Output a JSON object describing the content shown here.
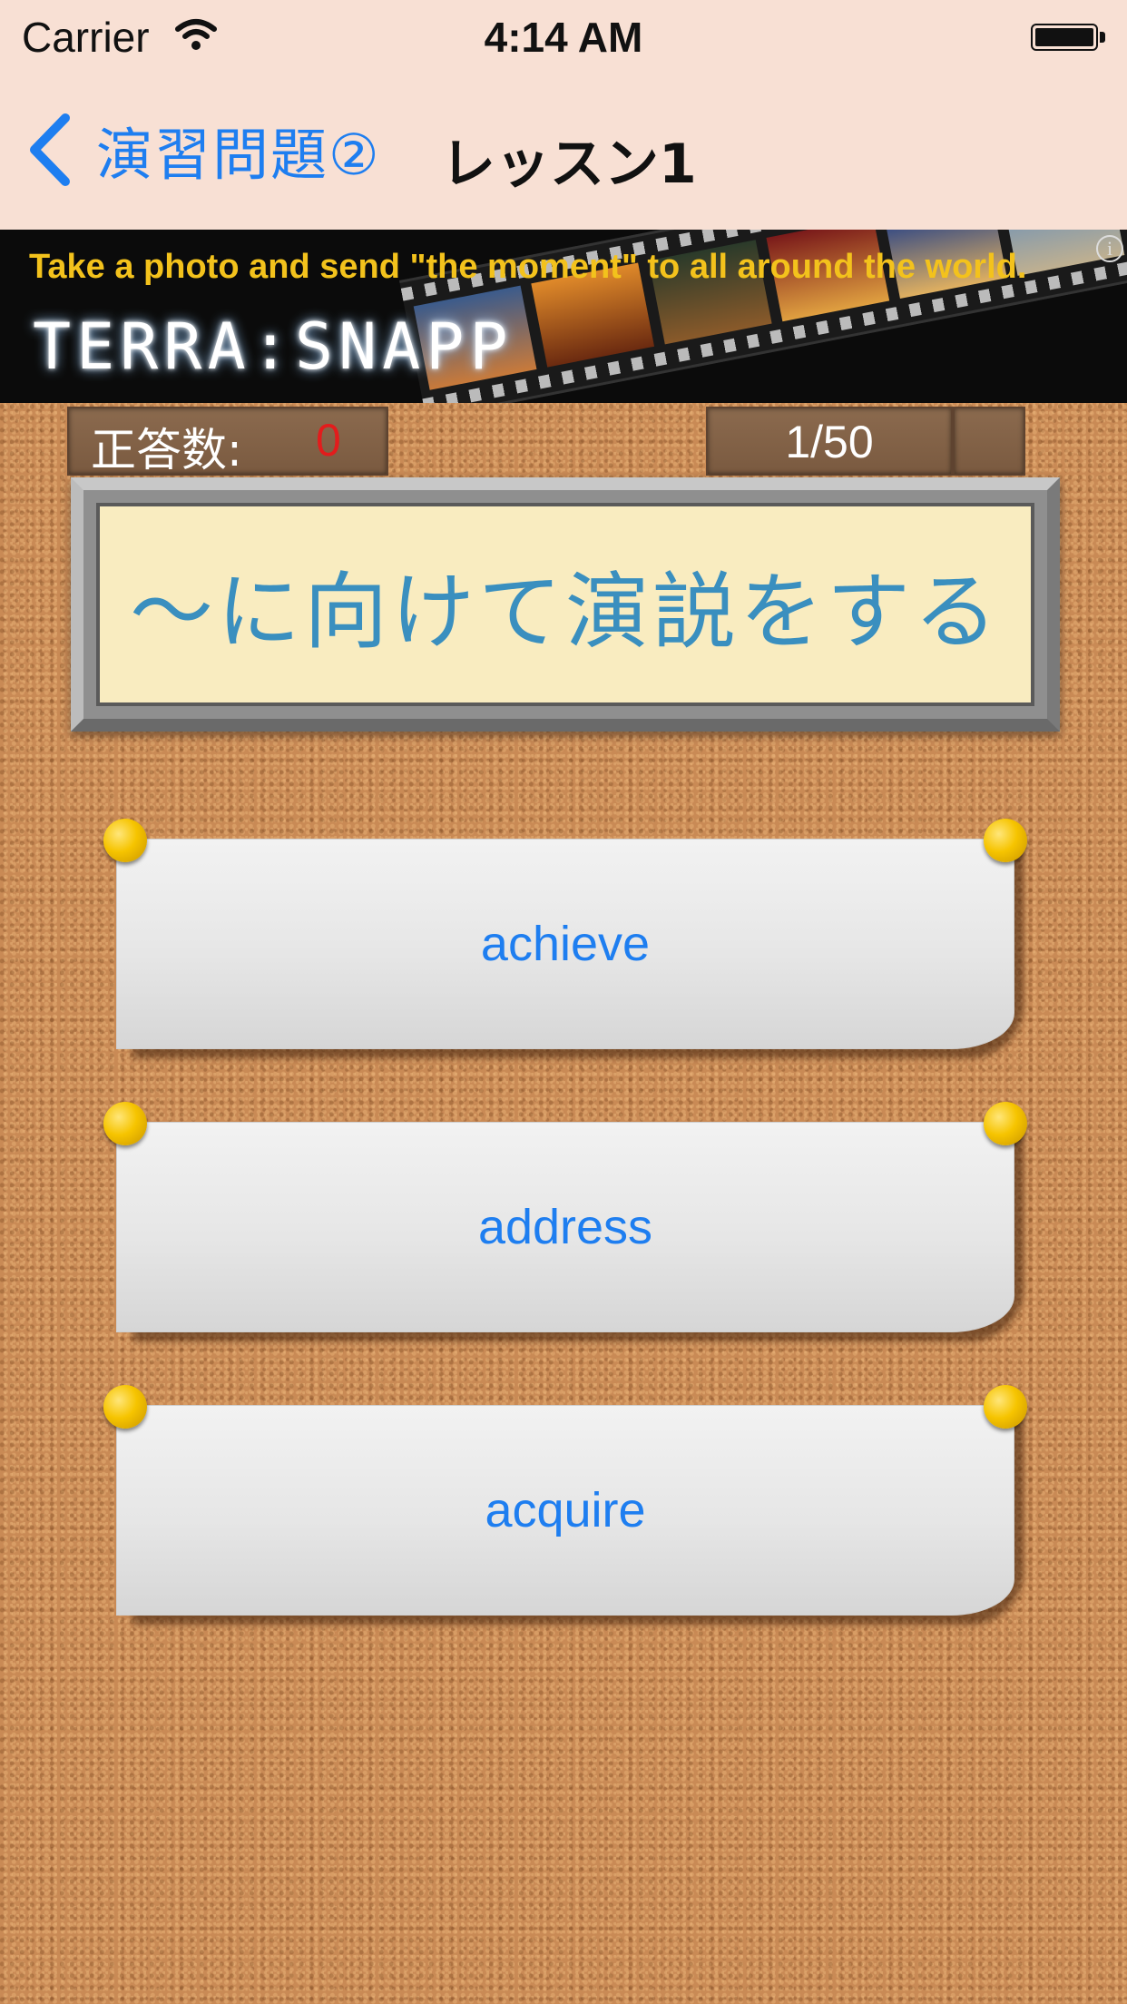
{
  "status_bar": {
    "carrier": "Carrier",
    "time": "4:14 AM",
    "wifi_icon": "wifi-icon",
    "battery_icon": "battery-icon"
  },
  "nav": {
    "back_label": "演習問題②",
    "title": "レッスン1",
    "accent_color": "#1e7ef0"
  },
  "ad": {
    "tagline": "Take a photo and send  \"the moment\" to all around the world.",
    "logo": "TERRA:SNAPP",
    "info_glyph": "i"
  },
  "score": {
    "label": "正答数:",
    "value": "0",
    "value_color": "#e31c1c"
  },
  "progress": {
    "text": "1/50"
  },
  "question": {
    "text": "～に向けて演説をする",
    "text_color": "#3a8fbf"
  },
  "answers": [
    {
      "label": "achieve"
    },
    {
      "label": "address"
    },
    {
      "label": "acquire"
    }
  ]
}
